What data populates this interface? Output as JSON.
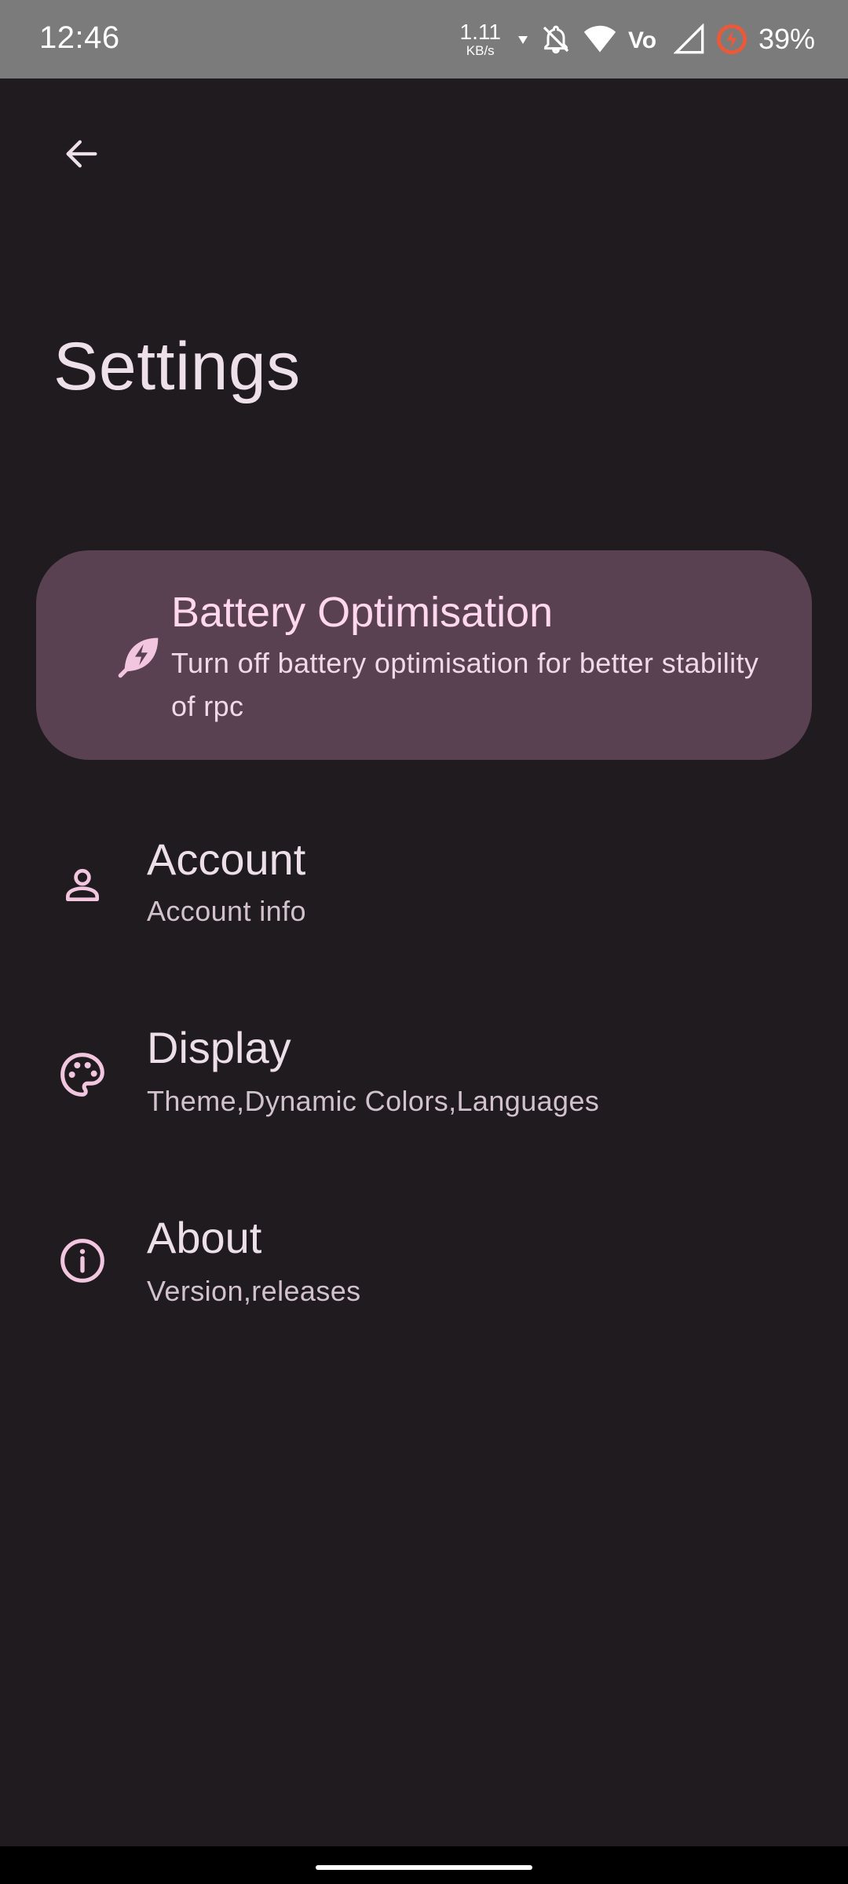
{
  "status_bar": {
    "time": "12:46",
    "net_speed_value": "1.11",
    "net_speed_unit": "KB/s",
    "battery_percent": "39%"
  },
  "header": {
    "back_icon": "arrow-left-icon",
    "title": "Settings"
  },
  "battery_card": {
    "icon": "leaf-bolt-icon",
    "title": "Battery Optimisation",
    "description": "Turn off battery optimisation for better stability of rpc"
  },
  "settings": [
    {
      "icon": "person-icon",
      "title": "Account",
      "subtitle": "Account info"
    },
    {
      "icon": "palette-icon",
      "title": "Display",
      "subtitle": "Theme,Dynamic Colors,Languages"
    },
    {
      "icon": "info-icon",
      "title": "About",
      "subtitle": "Version,releases"
    }
  ],
  "colors": {
    "background": "#1f1b1f",
    "card": "#5a4152",
    "accent_icon": "#f3c6df",
    "status_bar": "#7b7b7b"
  }
}
